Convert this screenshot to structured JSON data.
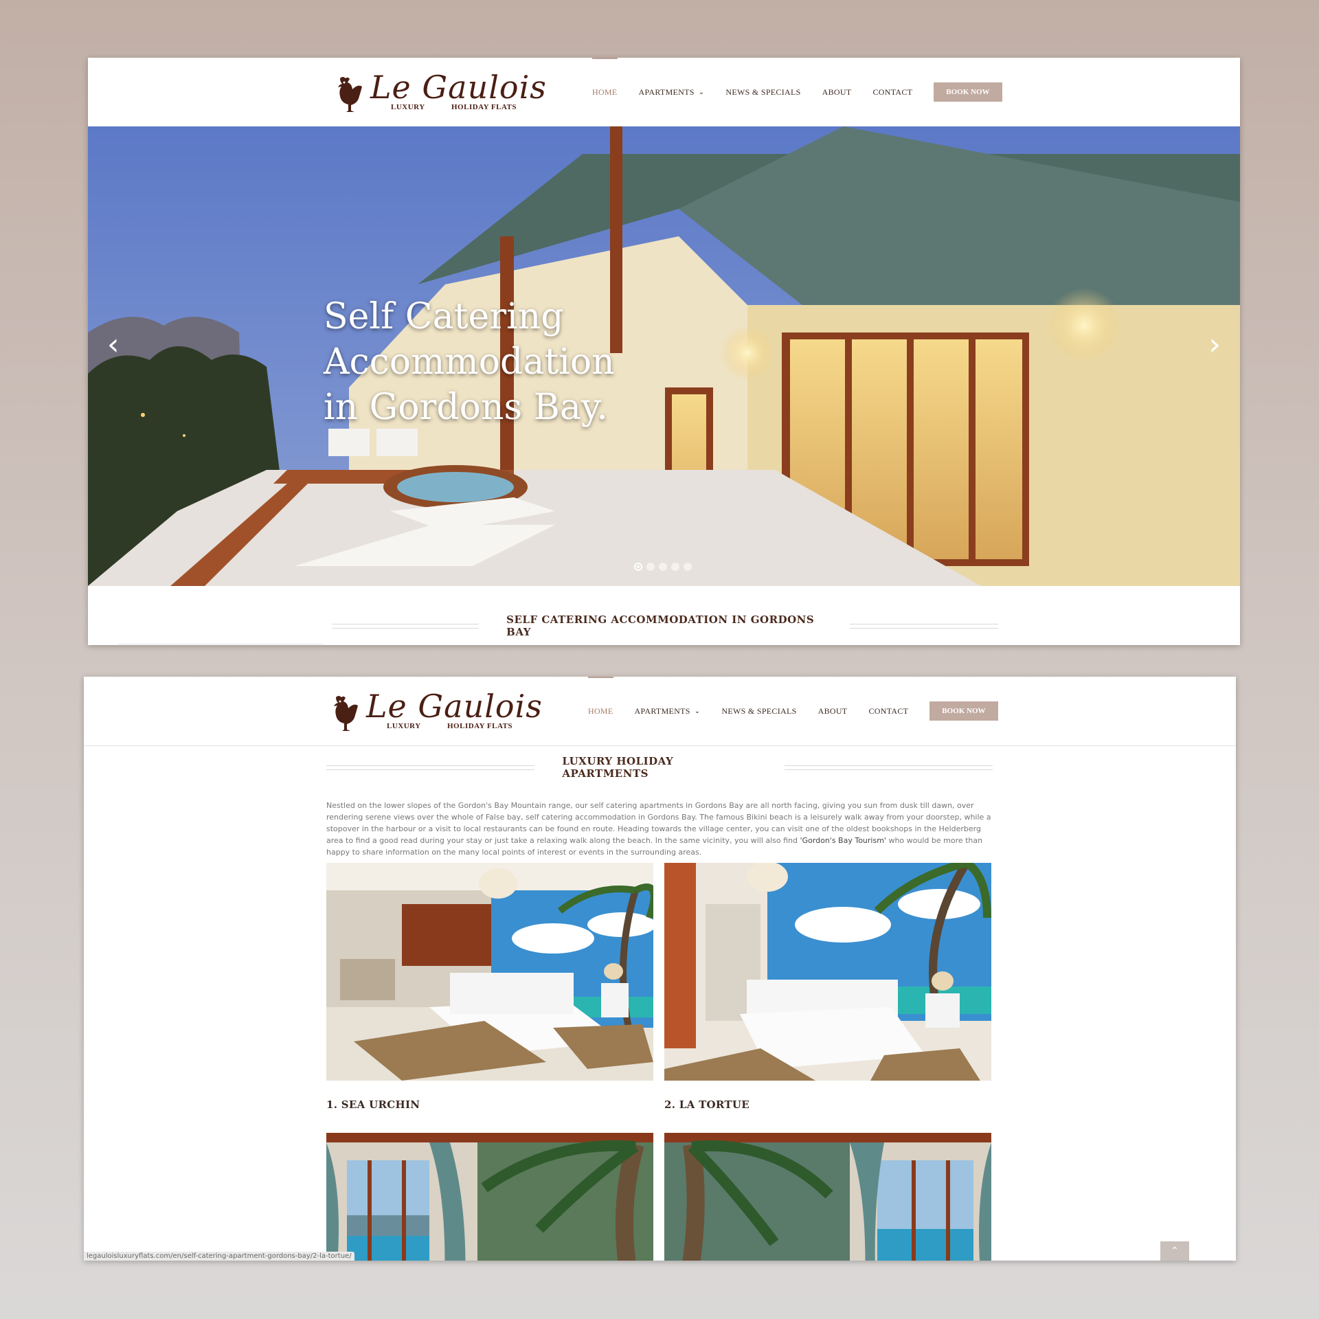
{
  "logo": {
    "brand": "Le Gaulois",
    "sub_left": "LUXURY",
    "sub_right": "HOLIDAY FLATS"
  },
  "nav": {
    "items": [
      {
        "label": "HOME",
        "active": true
      },
      {
        "label": "APARTMENTS",
        "dropdown": true
      },
      {
        "label": "NEWS & SPECIALS"
      },
      {
        "label": "ABOUT"
      },
      {
        "label": "CONTACT"
      }
    ],
    "chevron": "⌄",
    "book_label": "BOOK NOW"
  },
  "hero": {
    "title_line1": "Self Catering Accommodation",
    "title_line2": "in Gordons Bay.",
    "prev_icon": "‹",
    "next_icon": "›",
    "slide_count": 5,
    "active_slide": 1
  },
  "section1_title": "SELF CATERING ACCOMMODATION IN GORDONS BAY",
  "section2_title": "LUXURY HOLIDAY APARTMENTS",
  "intro": {
    "text": "Nestled on the lower slopes of the Gordon's Bay Mountain range, our self catering apartments in Gordons Bay are all north facing, giving you sun from dusk till dawn, over rendering serene views over the whole of False bay, self catering accommodation in Gordons Bay. The famous Bikini beach is a leisurely walk away from your doorstep, while a stopover in the harbour or a visit to local restaurants can be found en route. Heading towards the village center, you can visit one of the oldest bookshops in the Helderberg area to find a good read during your stay or just take a relaxing walk along the beach. In the same vicinity, you will also find ",
    "highlight": "'Gordon's Bay Tourism'",
    "tail": " who would be more than happy to share information on the many local points of interest or events in the surrounding areas."
  },
  "apartments": [
    {
      "name": "1. SEA URCHIN"
    },
    {
      "name": "2. LA TORTUE"
    },
    {
      "name": ""
    },
    {
      "name": ""
    }
  ],
  "status_url": "legauloisluxuryflats.com/en/self-catering-apartment-gordons-bay/2-la-tortue/",
  "scroll_top_icon": "⌃",
  "colors": {
    "brand": "#4a1f14",
    "accent": "#c1aaa0",
    "active_nav": "#a57a66"
  }
}
